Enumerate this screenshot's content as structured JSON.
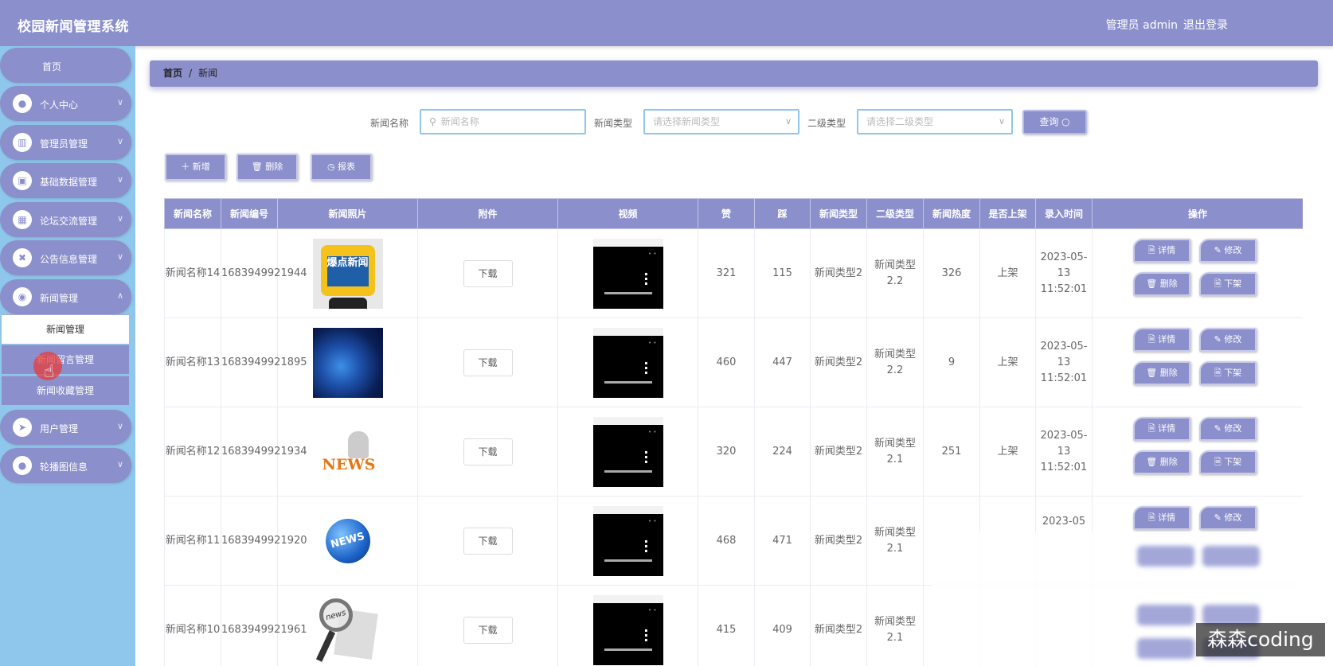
{
  "app": {
    "title": "校园新闻管理系统",
    "admin_label": "管理员 admin",
    "logout_label": "退出登录"
  },
  "sidebar": {
    "home": "首页",
    "items": [
      {
        "label": "个人中心",
        "icon": "user-icon"
      },
      {
        "label": "管理员管理",
        "icon": "book-icon"
      },
      {
        "label": "基础数据管理",
        "icon": "clipboard-icon"
      },
      {
        "label": "论坛交流管理",
        "icon": "grid-icon"
      },
      {
        "label": "公告信息管理",
        "icon": "ticket-icon"
      },
      {
        "label": "新闻管理",
        "icon": "location-icon"
      },
      {
        "label": "用户管理",
        "icon": "send-icon"
      },
      {
        "label": "轮播图信息",
        "icon": "person-icon"
      }
    ],
    "submenu": [
      "新闻管理",
      "新闻留言管理",
      "新闻收藏管理"
    ]
  },
  "breadcrumb": {
    "home": "首页",
    "separator": "/",
    "current": "新闻"
  },
  "search": {
    "name_label": "新闻名称",
    "name_placeholder": "新闻名称",
    "type_label": "新闻类型",
    "type_placeholder": "请选择新闻类型",
    "subtype_label": "二级类型",
    "subtype_placeholder": "请选择二级类型",
    "query_label": "查询 ○"
  },
  "toolbar": {
    "add_label": "＋ 新增",
    "delete_label": "🗑 删除",
    "report_label": "◷ 报表"
  },
  "table": {
    "headers": [
      "新闻名称",
      "新闻编号",
      "新闻照片",
      "附件",
      "视频",
      "赞",
      "踩",
      "新闻类型",
      "二级类型",
      "新闻热度",
      "是否上架",
      "录入时间",
      "操作"
    ],
    "download_label": "下载",
    "ops": {
      "detail": "🗎 详情",
      "edit": "✎ 修改",
      "delete": "🗑 删除",
      "offshelf": "🗎 下架"
    },
    "rows": [
      {
        "name": "新闻名称14",
        "code": "1683949921944",
        "like": "321",
        "dislike": "115",
        "type": "新闻类型2",
        "subtype": "新闻类型2.2",
        "heat": "326",
        "shelf": "上架",
        "time": "2023-05-13 11:52:01"
      },
      {
        "name": "新闻名称13",
        "code": "1683949921895",
        "like": "460",
        "dislike": "447",
        "type": "新闻类型2",
        "subtype": "新闻类型2.2",
        "heat": "9",
        "shelf": "上架",
        "time": "2023-05-13 11:52:01"
      },
      {
        "name": "新闻名称12",
        "code": "1683949921934",
        "like": "320",
        "dislike": "224",
        "type": "新闻类型2",
        "subtype": "新闻类型2.1",
        "heat": "251",
        "shelf": "上架",
        "time": "2023-05-13 11:52:01"
      },
      {
        "name": "新闻名称11",
        "code": "1683949921920",
        "like": "468",
        "dislike": "471",
        "type": "新闻类型2",
        "subtype": "新闻类型2.1",
        "heat": "",
        "shelf": "",
        "time": "2023-05"
      },
      {
        "name": "新闻名称10",
        "code": "1683949921961",
        "like": "415",
        "dislike": "409",
        "type": "新闻类型2",
        "subtype": "新闻类型2.1",
        "heat": "",
        "shelf": "",
        "time": ""
      }
    ]
  },
  "thumb_texts": {
    "t1": "爆点新闻",
    "t3": "NEWS",
    "t4": "NEWS",
    "t5": "news"
  },
  "watermark": "森森coding",
  "colors": {
    "primary": "#8b8fcb",
    "sidebar_bg": "#8fc7ec",
    "accent_cursor": "#e63c3c"
  }
}
